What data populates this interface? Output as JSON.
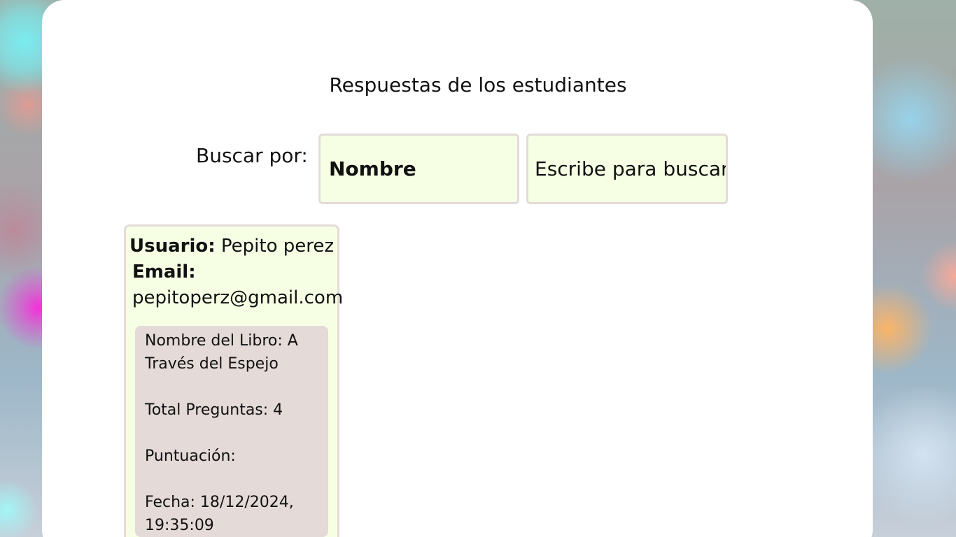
{
  "page": {
    "title": "Respuestas de los estudiantes"
  },
  "search": {
    "label": "Buscar por:",
    "filter_selected": "Nombre",
    "placeholder": "Escribe para buscar"
  },
  "students": [
    {
      "user_label": "Usuario:",
      "user_value": "Pepito perez",
      "email_label": "Email:",
      "email_value": "pepitoperz@gmail.com",
      "result": {
        "book": "Nombre del Libro: A Través del Espejo",
        "total_questions": "Total Preguntas: 4",
        "score": "Puntuación:",
        "date": "Fecha: 18/12/2024, 19:35:09"
      }
    }
  ]
}
